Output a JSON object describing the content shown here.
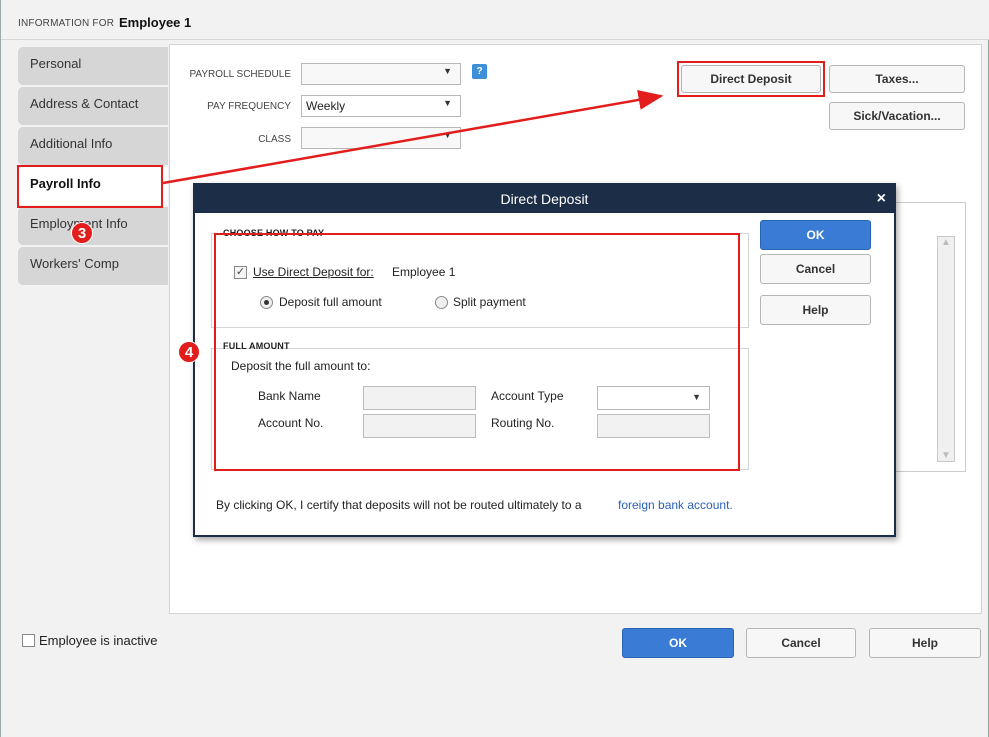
{
  "header": {
    "label": "INFORMATION FOR",
    "employee": "Employee 1"
  },
  "sidebar": {
    "items": [
      {
        "label": "Personal",
        "active": false
      },
      {
        "label": "Address & Contact",
        "active": false
      },
      {
        "label": "Additional Info",
        "active": false
      },
      {
        "label": "Payroll Info",
        "active": true
      },
      {
        "label": "Employment Info",
        "active": false
      },
      {
        "label": "Workers' Comp",
        "active": false
      }
    ]
  },
  "payroll": {
    "schedule_label": "PAYROLL SCHEDULE",
    "schedule_value": "",
    "help_glyph": "?",
    "frequency_label": "PAY FREQUENCY",
    "frequency_value": "Weekly",
    "class_label": "CLASS",
    "class_value": "",
    "direct_deposit_button": "Direct Deposit",
    "taxes_button": "Taxes...",
    "sick_vacation_button": "Sick/Vacation..."
  },
  "dialog": {
    "title": "Direct Deposit",
    "close_glyph": "×",
    "section_how": "CHOOSE HOW TO PAY",
    "use_dd_label": "Use Direct Deposit for:",
    "use_dd_employee": "Employee 1",
    "use_dd_checked": true,
    "radio_full": "Deposit full amount",
    "radio_split": "Split payment",
    "selected_option": "Deposit full amount",
    "section_full": "FULL AMOUNT",
    "deposit_to_label": "Deposit the full amount to:",
    "bank_name_label": "Bank Name",
    "account_no_label": "Account No.",
    "account_type_label": "Account Type",
    "routing_no_label": "Routing No.",
    "bank_name_value": "",
    "account_no_value": "",
    "account_type_value": "",
    "routing_no_value": "",
    "ok_button": "OK",
    "cancel_button": "Cancel",
    "help_button": "Help",
    "certify_text": "By clicking OK, I certify that deposits will not be routed ultimately to a",
    "certify_link": "foreign bank account."
  },
  "annotations": {
    "step3": "3",
    "step4": "4",
    "highlight_color": "#e31c1c"
  },
  "footer": {
    "inactive_label": "Employee is inactive",
    "inactive_checked": false,
    "ok_button": "OK",
    "cancel_button": "Cancel",
    "help_button": "Help"
  },
  "colors": {
    "primary_button": "#3a7bd5",
    "dialog_title_bg": "#1c2d48",
    "link": "#2b61b8"
  }
}
